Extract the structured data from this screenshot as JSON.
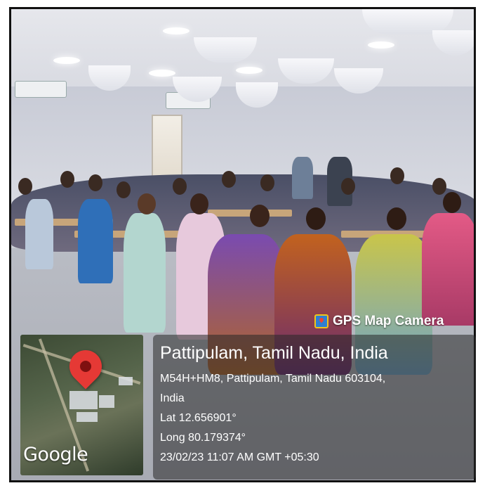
{
  "overlay": {
    "app_label": "GPS Map Camera",
    "map_provider": "Google",
    "location_title": "Pattipulam, Tamil Nadu, India",
    "address_line1": "M54H+HM8, Pattipulam, Tamil Nadu 603104,",
    "address_line2": "India",
    "latitude": "Lat 12.656901°",
    "longitude": "Long 80.179374°",
    "timestamp": "23/02/23 11:07 AM GMT +05:30"
  },
  "colors": {
    "pin": "#e53935",
    "panel": "rgba(40,40,40,0.55)",
    "text": "#ffffff"
  },
  "icons": {
    "camera": "gps-map-camera-icon",
    "pin": "map-pin-icon"
  }
}
